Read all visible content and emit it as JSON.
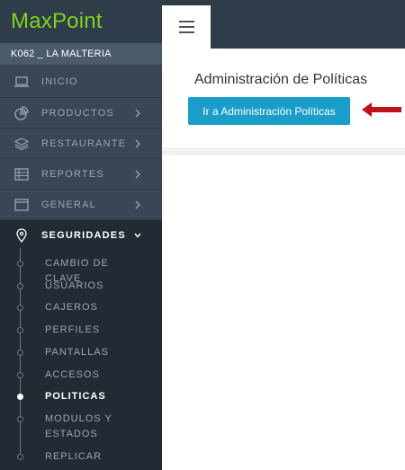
{
  "brand": "MaxPoint",
  "store": "K062 _ LA MALTERIA",
  "menu": [
    {
      "label": "INICIO",
      "icon": "laptop-icon",
      "has_chevron": false
    },
    {
      "label": "PRODUCTOS",
      "icon": "pie-chart-icon",
      "has_chevron": true
    },
    {
      "label": "RESTAURANTE",
      "icon": "layers-icon",
      "has_chevron": true
    },
    {
      "label": "REPORTES",
      "icon": "report-icon",
      "has_chevron": true
    },
    {
      "label": "GENERAL",
      "icon": "window-icon",
      "has_chevron": true
    },
    {
      "label": "SEGURIDADES",
      "icon": "map-pin-icon",
      "has_chevron": true,
      "expanded": true
    }
  ],
  "submenu": [
    {
      "label": "CAMBIO DE CLAVE"
    },
    {
      "label": "USUARIOS"
    },
    {
      "label": "CAJEROS"
    },
    {
      "label": "PERFILES"
    },
    {
      "label": "PANTALLAS"
    },
    {
      "label": "ACCESOS"
    },
    {
      "label": "POLITICAS",
      "selected": true
    },
    {
      "label": "MODULOS Y ESTADOS"
    },
    {
      "label": "REPLICAR"
    }
  ],
  "main": {
    "title": "Administración de Políticas",
    "button_label": "Ir a Administración Políticas"
  },
  "colors": {
    "sidebar_bg": "#384655",
    "brand_green": "#7ed321",
    "button_blue": "#1a9dc9",
    "arrow_red": "#c0121b"
  }
}
